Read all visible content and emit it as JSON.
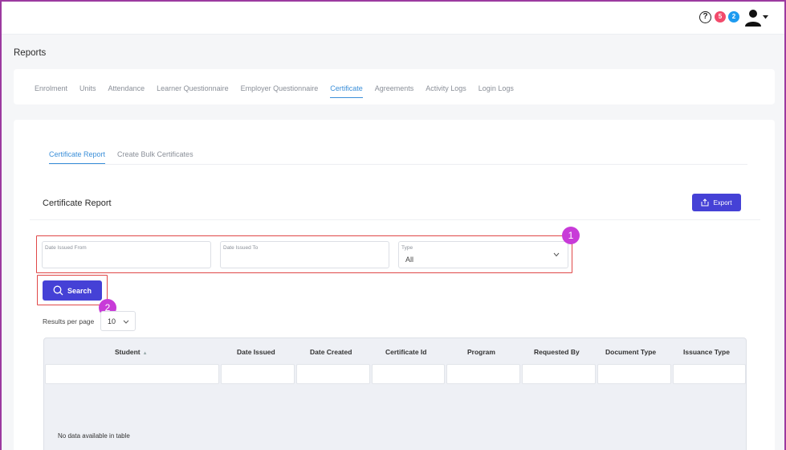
{
  "header": {
    "help_glyph": "?",
    "badge_alerts": "5",
    "badge_messages": "2",
    "colors": {
      "badge_alerts": "#f24a6b",
      "badge_messages": "#1e9bf0"
    },
    "icons": {
      "help": "help-circle-icon",
      "user": "user-icon",
      "menu": "caret-down-icon"
    }
  },
  "page": {
    "title": "Reports"
  },
  "tabs": [
    {
      "label": "Enrolment",
      "active": false
    },
    {
      "label": "Units",
      "active": false
    },
    {
      "label": "Attendance",
      "active": false
    },
    {
      "label": "Learner Questionnaire",
      "active": false
    },
    {
      "label": "Employer Questionnaire",
      "active": false
    },
    {
      "label": "Certificate",
      "active": true
    },
    {
      "label": "Agreements",
      "active": false
    },
    {
      "label": "Activity Logs",
      "active": false
    },
    {
      "label": "Login Logs",
      "active": false
    }
  ],
  "subtabs": [
    {
      "label": "Certificate Report",
      "active": true
    },
    {
      "label": "Create Bulk Certificates",
      "active": false
    }
  ],
  "report": {
    "title": "Certificate Report",
    "export_label": "Export"
  },
  "filters": {
    "date_from_label": "Date Issued From",
    "date_from_value": "",
    "date_to_label": "Date Issued To",
    "date_to_value": "",
    "type_label": "Type",
    "type_value": "All"
  },
  "search_label": "Search",
  "callouts": {
    "one": "1",
    "two": "2"
  },
  "pagination": {
    "label": "Results per page",
    "value": "10"
  },
  "table": {
    "columns": [
      "Student",
      "Date Issued",
      "Date Created",
      "Certificate Id",
      "Program",
      "Requested By",
      "Document Type",
      "Issuance Type"
    ],
    "empty_message": "No data available in table"
  },
  "colors": {
    "primary": "#4541d6",
    "active_tab": "#3b8fd9",
    "highlight": "#e04848",
    "callout": "#c83bd8"
  }
}
